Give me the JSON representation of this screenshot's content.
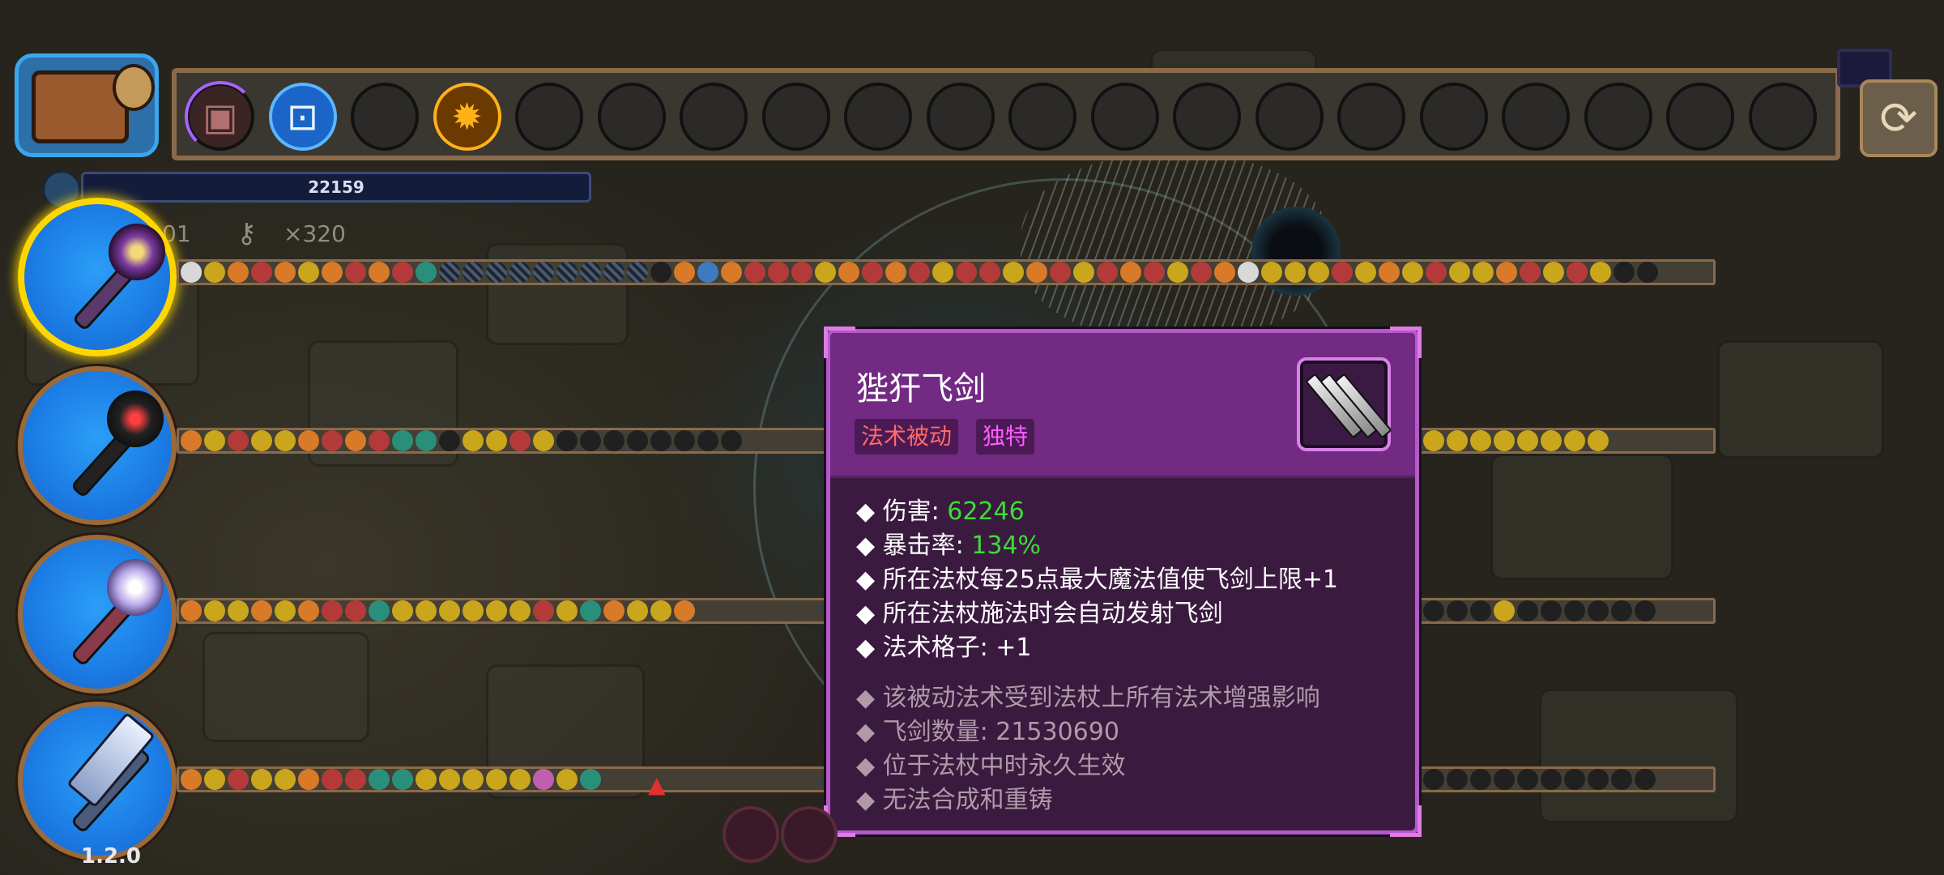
{
  "version": "1.2.0",
  "mana": {
    "value": "22159"
  },
  "keys": {
    "partial_count": "01",
    "key_icon": "key-icon",
    "count": "×320"
  },
  "top_bar": {
    "slots": [
      {
        "icon": "web-rune-icon",
        "glyph": "▣"
      },
      {
        "icon": "spiral-rune-icon",
        "glyph": "⊡"
      },
      {
        "icon": "empty",
        "glyph": ""
      },
      {
        "icon": "sun-rune-icon",
        "glyph": "✹"
      },
      {
        "icon": "empty",
        "glyph": ""
      },
      {
        "icon": "empty",
        "glyph": ""
      },
      {
        "icon": "empty",
        "glyph": ""
      },
      {
        "icon": "empty",
        "glyph": ""
      },
      {
        "icon": "empty",
        "glyph": ""
      },
      {
        "icon": "empty",
        "glyph": ""
      },
      {
        "icon": "empty",
        "glyph": ""
      },
      {
        "icon": "empty",
        "glyph": ""
      },
      {
        "icon": "empty",
        "glyph": ""
      },
      {
        "icon": "empty",
        "glyph": ""
      },
      {
        "icon": "empty",
        "glyph": ""
      },
      {
        "icon": "empty",
        "glyph": ""
      },
      {
        "icon": "empty",
        "glyph": ""
      },
      {
        "icon": "empty",
        "glyph": ""
      },
      {
        "icon": "empty",
        "glyph": ""
      },
      {
        "icon": "empty",
        "glyph": ""
      }
    ],
    "refresh_icon": "refresh-icon",
    "refresh_glyph": "⟳"
  },
  "wands": [
    {
      "name": "purple-star-staff",
      "selected": true
    },
    {
      "name": "dark-thorn-staff",
      "selected": false
    },
    {
      "name": "crystal-star-staff",
      "selected": false
    },
    {
      "name": "crystal-sword",
      "selected": false
    }
  ],
  "spell_rows": [
    {
      "icons": "wyoroyororgsssssssssdoborrryororyrryoryroryrowyyyryoyryyoryrydd"
    },
    {
      "icons": "oyryyororggdyyrydddddddd"
    },
    {
      "icons": "oyyoyorrgyyyyyyrygoyyo"
    },
    {
      "icons": "oyryyorrggyyyyypyg"
    }
  ],
  "spell_rows_right": [
    {
      "icons": "yyyyyyyy"
    },
    {
      "icons": "dddydddddd"
    },
    {
      "icons": "dddddddddd"
    }
  ],
  "tooltip": {
    "title": "狴犴飞剑",
    "tags": [
      "法术被动",
      "独特"
    ],
    "icon": "flying-swords-icon",
    "stats": [
      {
        "label": "伤害: ",
        "value": "62246"
      },
      {
        "label": "暴击率: ",
        "value": "134%"
      },
      {
        "label": "所在法杖每25点最大魔法值使飞剑上限+1",
        "value": ""
      },
      {
        "label": "所在法杖施法时会自动发射飞剑",
        "value": ""
      },
      {
        "label": "法术格子: +1",
        "value": ""
      }
    ],
    "notes": [
      "该被动法术受到法杖上所有法术增强影响",
      "飞剑数量: 21530690",
      "位于法杖中时永久生效",
      "无法合成和重铸"
    ]
  },
  "colors": {
    "tooltip_bg": "#3b1a40",
    "tooltip_border": "#b35ac8",
    "stat_value": "#3ddc36",
    "tag_red": "#ff6a6a",
    "tag_magenta": "#ff5cff"
  }
}
